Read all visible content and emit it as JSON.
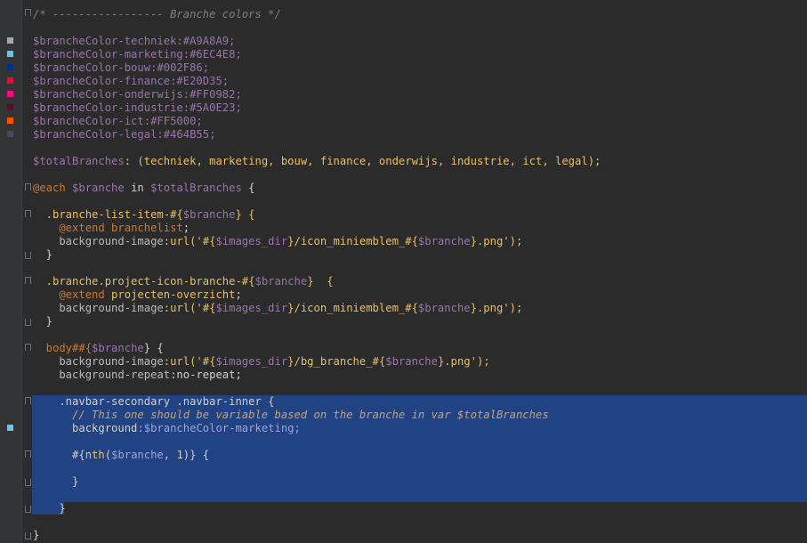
{
  "colors": {
    "techniek": "#A9A8A9",
    "marketing": "#6EC4E8",
    "bouw": "#002F86",
    "finance": "#E20D35",
    "onderwijs": "#FF0982",
    "industrie": "#5A0E23",
    "ict": "#FF5000",
    "legal": "#464B55"
  },
  "lines": {
    "l1": "/* ----------------- Branche colors */",
    "l3": "$brancheColor-techniek:#A9A8A9;",
    "l4": "$brancheColor-marketing:#6EC4E8;",
    "l5": "$brancheColor-bouw:#002F86;",
    "l6": "$brancheColor-finance:#E20D35;",
    "l7": "$brancheColor-onderwijs:#FF0982;",
    "l8": "$brancheColor-industrie:#5A0E23;",
    "l9": "$brancheColor-ict:#FF5000;",
    "l10": "$brancheColor-legal:#464B55;",
    "l12a": "$totalBranches",
    "l12b": ": (techniek, marketing, bouw, finance, onderwijs, industrie, ict, legal);",
    "l14a": "@each",
    "l14b": " $branche",
    "l14c": " in ",
    "l14d": "$totalBranches",
    "l14e": " {",
    "l16a": "  .branche-list-item-#{",
    "l16b": "$branche",
    "l16c": "} {",
    "l17a": "    @extend",
    "l17b": " branchelist",
    "l17c": ";",
    "l18a": "    background-image",
    "l18b": ":url('#{",
    "l18c": "$images_dir",
    "l18d": "}/icon_miniemblem_#{",
    "l18e": "$branche",
    "l18f": "}.png');",
    "l19": "  }",
    "l21a": "  .branche.project-icon-branche-#{",
    "l21b": "$branche",
    "l21c": "}  {",
    "l22a": "    @extend",
    "l22b": " projecten-overzicht",
    "l22c": ";",
    "l23a": "    background-image",
    "l23b": ":url('#{",
    "l23c": "$images_dir",
    "l23d": "}/icon_miniemblem_#{",
    "l23e": "$branche",
    "l23f": "}.png');",
    "l24": "  }",
    "l26a": "  body##{",
    "l26b": "$branche",
    "l26c": "} {",
    "l27a": "    background-image",
    "l27b": ":url('#{",
    "l27c": "$images_dir",
    "l27d": "}/bg_branche_#{",
    "l27e": "$branche",
    "l27f": "}.png');",
    "l28a": "    background-repeat",
    "l28b": ":no-repeat;",
    "l30": "    .navbar-secondary .navbar-inner {",
    "l31": "      // This one should be variable based on the branche in var $totalBranches",
    "l32a": "      background",
    "l32b": ":$brancheColor-marketing;",
    "l34a": "      #{",
    "l34b": "nth",
    "l34c": "(",
    "l34d": "$branche",
    "l34e": ", 1)} {",
    "l36": "      }",
    "l38": "    }",
    "l40": "}"
  }
}
